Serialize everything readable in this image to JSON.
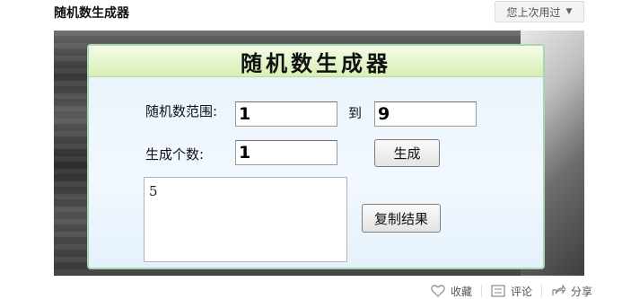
{
  "page": {
    "title": "随机数生成器",
    "used_button": "您上次用过"
  },
  "panel": {
    "title": "随机数生成器",
    "range_label": "随机数范围:",
    "range_from": "1",
    "range_to_label": "到",
    "range_to": "9",
    "count_label": "生成个数:",
    "count_value": "1",
    "generate_button": "生成",
    "result_text": "5",
    "copy_button": "复制结果"
  },
  "footer": {
    "collect": "收藏",
    "comment": "评论",
    "share": "分享"
  }
}
